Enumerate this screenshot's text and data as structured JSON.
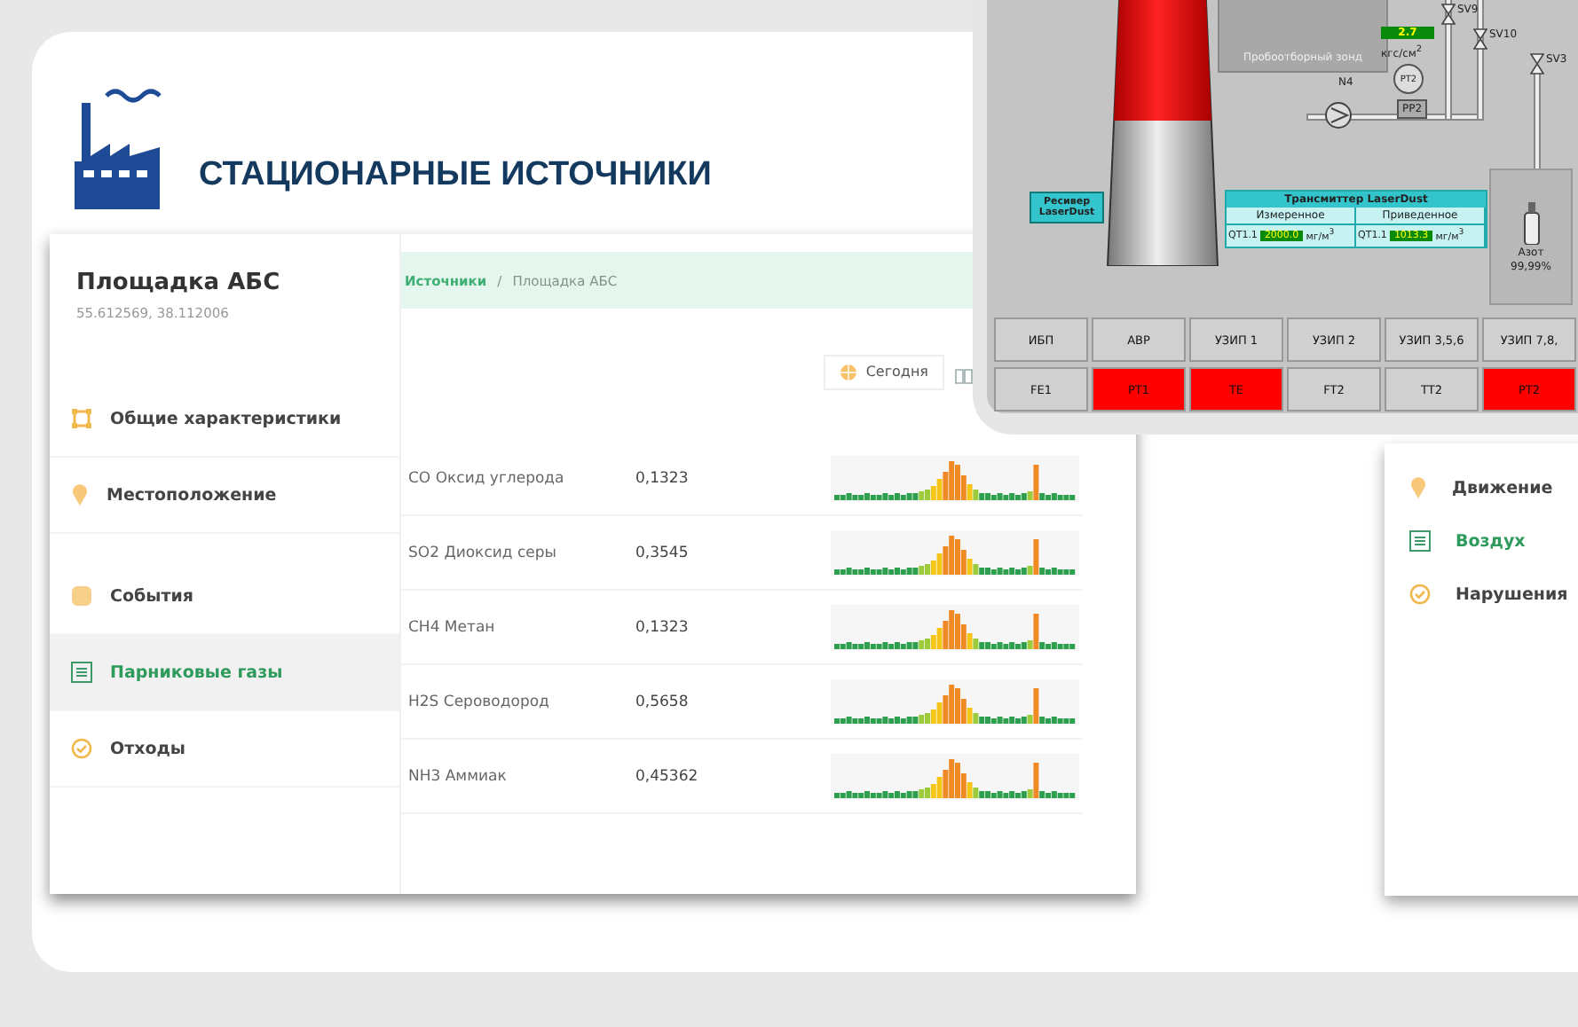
{
  "header": {
    "title": "СТАЦИОНАРНЫЕ ИСТОЧНИКИ"
  },
  "site": {
    "name": "Площадка АБС",
    "coords": "55.612569, 38.112006"
  },
  "sidebar": {
    "items": [
      {
        "label": "Общие характеристики",
        "kind": "frame",
        "selected": false
      },
      {
        "label": "Местоположение",
        "kind": "pin",
        "selected": false
      },
      {
        "label": "События",
        "kind": "events",
        "selected": false
      },
      {
        "label": "Парниковые газы",
        "kind": "list",
        "selected": true
      },
      {
        "label": "Отходы",
        "kind": "check",
        "selected": false
      }
    ]
  },
  "breadcrumb": [
    "Источники",
    "Площадка АБС"
  ],
  "breadcrumb_separator": "/",
  "date_button": {
    "label": "Сегодня"
  },
  "gases": [
    {
      "name": "CO Оксид углерода",
      "value": "0,1323"
    },
    {
      "name": "SO2 Диоксид серы",
      "value": "0,3545"
    },
    {
      "name": "CH4 Метан",
      "value": "0,1323"
    },
    {
      "name": "H2S Сероводород",
      "value": "0,5658"
    },
    {
      "name": "NH3 Аммиак",
      "value": "0,45362"
    }
  ],
  "scada": {
    "probe": "Пробоотборный зонд",
    "pressure_value": "2.7",
    "pressure_unit": "кгс/см$^{2}$",
    "gauge": "PT2",
    "pump": "N4",
    "pp": "PP2",
    "valves": [
      "SV9",
      "SV10",
      "SV3"
    ],
    "receiver": "Ресивер LaserDust",
    "transmitter": {
      "title": "Трансмиттер LaserDust",
      "columns": [
        {
          "header": "Измеренное",
          "tag": "QT1.1",
          "value": "2000.0",
          "unit": "мг/м$^{3}$"
        },
        {
          "header": "Приведенное",
          "tag": "QT1.1",
          "value": "1013.3",
          "unit": "мг/м$^{3}$"
        }
      ]
    },
    "gas_bottle": {
      "name": "Азот",
      "purity": "99,99%"
    },
    "button_rows": [
      [
        {
          "label": "ИБП",
          "alarm": false
        },
        {
          "label": "АВР",
          "alarm": false
        },
        {
          "label": "УЗИП 1",
          "alarm": false
        },
        {
          "label": "УЗИП 2",
          "alarm": false
        },
        {
          "label": "УЗИП 3,5,6",
          "alarm": false
        },
        {
          "label": "УЗИП 7,8,",
          "alarm": false
        }
      ],
      [
        {
          "label": "FE1",
          "alarm": false
        },
        {
          "label": "PT1",
          "alarm": true
        },
        {
          "label": "TE",
          "alarm": true
        },
        {
          "label": "FT2",
          "alarm": false
        },
        {
          "label": "TT2",
          "alarm": false
        },
        {
          "label": "PT2",
          "alarm": true
        }
      ]
    ]
  },
  "right_panel": {
    "items": [
      {
        "label": "Движение",
        "kind": "pin",
        "selected": false
      },
      {
        "label": "Воздух",
        "kind": "list",
        "selected": true
      },
      {
        "label": "Нарушения",
        "kind": "check",
        "selected": false
      }
    ]
  }
}
